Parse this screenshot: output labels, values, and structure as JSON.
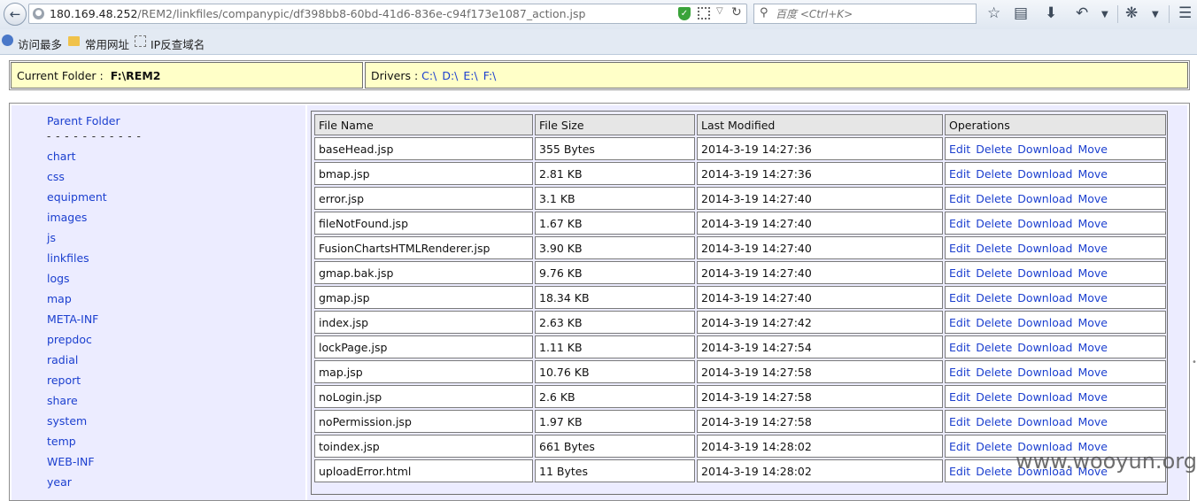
{
  "browser": {
    "url_host": "180.169.48.252",
    "url_path": "/REM2/linkfiles/companypic/df398bb8-60bd-41d6-836e-c94f173e1087_action.jsp",
    "search_placeholder": "百度 <Ctrl+K>",
    "bookmarks": [
      "访问最多",
      "常用网址",
      "IP反查域名"
    ]
  },
  "folder_bar": {
    "current_label": "Current Folder :",
    "current_value": "F:\\REM2",
    "drivers_label": "Drivers :",
    "drives": [
      "C:\\",
      "D:\\",
      "E:\\",
      "F:\\"
    ]
  },
  "sidebar": {
    "parent_label": "Parent Folder",
    "separator": "- - - - - - - - - - -",
    "folders": [
      "chart",
      "css",
      "equipment",
      "images",
      "js",
      "linkfiles",
      "logs",
      "map",
      "META-INF",
      "prepdoc",
      "radial",
      "report",
      "share",
      "system",
      "temp",
      "WEB-INF",
      "year"
    ]
  },
  "table": {
    "headers": [
      "File Name",
      "File Size",
      "Last Modified",
      "Operations"
    ],
    "operations": [
      "Edit",
      "Delete",
      "Download",
      "Move"
    ],
    "rows": [
      {
        "name": "baseHead.jsp",
        "size": "355 Bytes",
        "modified": "2014-3-19 14:27:36"
      },
      {
        "name": "bmap.jsp",
        "size": "2.81 KB",
        "modified": "2014-3-19 14:27:36"
      },
      {
        "name": "error.jsp",
        "size": "3.1 KB",
        "modified": "2014-3-19 14:27:40"
      },
      {
        "name": "fileNotFound.jsp",
        "size": "1.67 KB",
        "modified": "2014-3-19 14:27:40"
      },
      {
        "name": "FusionChartsHTMLRenderer.jsp",
        "size": "3.90 KB",
        "modified": "2014-3-19 14:27:40"
      },
      {
        "name": "gmap.bak.jsp",
        "size": "9.76 KB",
        "modified": "2014-3-19 14:27:40"
      },
      {
        "name": "gmap.jsp",
        "size": "18.34 KB",
        "modified": "2014-3-19 14:27:40"
      },
      {
        "name": "index.jsp",
        "size": "2.63 KB",
        "modified": "2014-3-19 14:27:42"
      },
      {
        "name": "lockPage.jsp",
        "size": "1.11 KB",
        "modified": "2014-3-19 14:27:54"
      },
      {
        "name": "map.jsp",
        "size": "10.76 KB",
        "modified": "2014-3-19 14:27:58"
      },
      {
        "name": "noLogin.jsp",
        "size": "2.6 KB",
        "modified": "2014-3-19 14:27:58"
      },
      {
        "name": "noPermission.jsp",
        "size": "1.97 KB",
        "modified": "2014-3-19 14:27:58"
      },
      {
        "name": "toindex.jsp",
        "size": "661 Bytes",
        "modified": "2014-3-19 14:28:02"
      },
      {
        "name": "uploadError.html",
        "size": "11 Bytes",
        "modified": "2014-3-19 14:28:02"
      }
    ]
  },
  "watermark": "www.wooyun.org"
}
